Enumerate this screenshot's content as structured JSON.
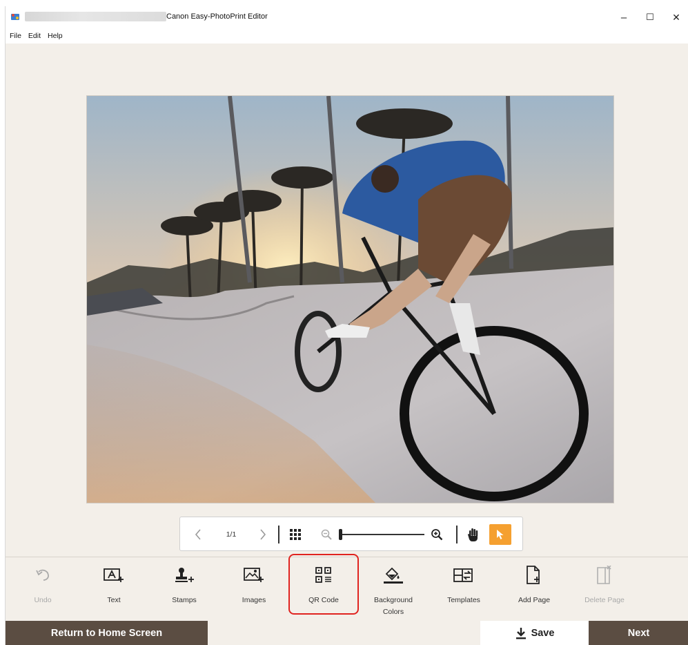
{
  "window": {
    "title": "Canon Easy-PhotoPrint Editor",
    "controls": {
      "minimize": "–",
      "maximize": "☐",
      "close": "✕"
    }
  },
  "menu": {
    "items": [
      "File",
      "Edit",
      "Help"
    ]
  },
  "canvas": {
    "photo_description_icon": "photo-skatepark-bmx"
  },
  "navigation": {
    "page_indicator": "1/1",
    "icons": [
      "chevron-left-icon",
      "chevron-right-icon",
      "grid-view-icon",
      "zoom-out-icon",
      "zoom-slider",
      "zoom-in-icon",
      "hand-pan-icon",
      "pointer-select-icon"
    ],
    "zoom_level": 0.0,
    "active_tool": "pointer-select"
  },
  "tools": [
    {
      "label": "Undo",
      "icon": "undo-icon",
      "disabled": true
    },
    {
      "label": "Text",
      "icon": "text-icon",
      "disabled": false
    },
    {
      "label": "Stamps",
      "icon": "stamp-icon",
      "disabled": false
    },
    {
      "label": "Images",
      "icon": "images-icon",
      "disabled": false
    },
    {
      "label": "QR Code",
      "icon": "qr-code-icon",
      "disabled": false,
      "highlighted": true
    },
    {
      "label": "Background Colors",
      "icon": "paint-bucket-icon",
      "disabled": false
    },
    {
      "label": "Templates",
      "icon": "templates-icon",
      "disabled": false
    },
    {
      "label": "Add Page",
      "icon": "add-page-icon",
      "disabled": false
    },
    {
      "label": "Delete Page",
      "icon": "delete-page-icon",
      "disabled": true
    }
  ],
  "actions": {
    "home": "Return to Home Screen",
    "save": "Save",
    "next": "Next"
  },
  "colors": {
    "accent_orange": "#f5a030",
    "bar_brown": "#5b4d42",
    "highlight_red": "#e0231f",
    "background": "#f3efe9"
  }
}
